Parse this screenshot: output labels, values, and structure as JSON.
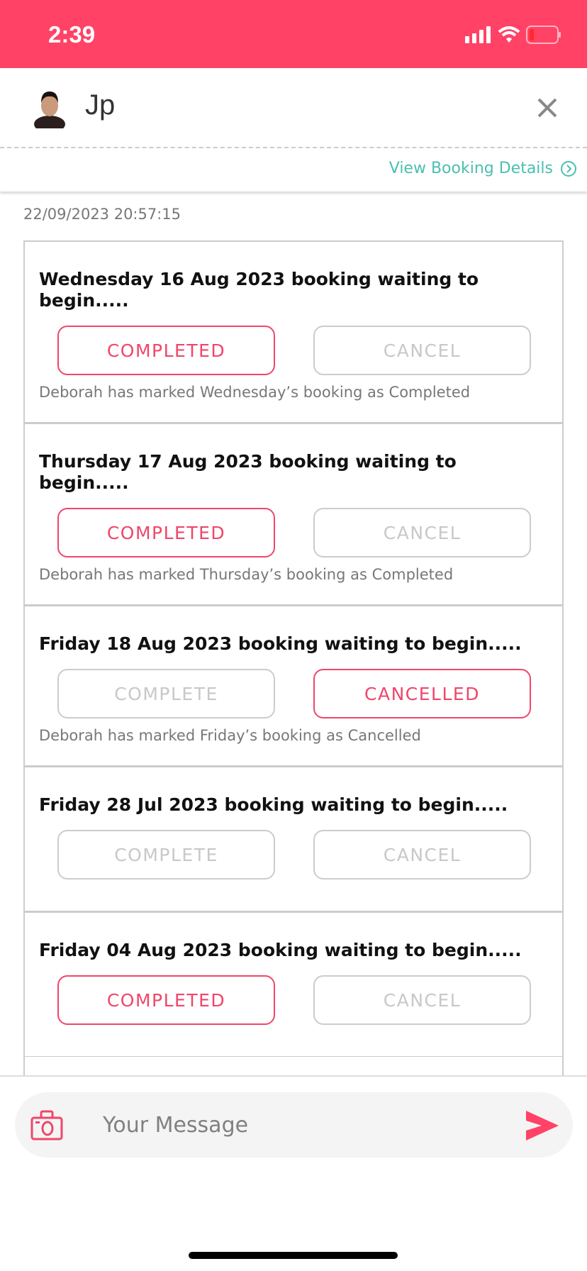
{
  "status_bar": {
    "time": "2:39",
    "icons": [
      "signal-icon",
      "wifi-icon",
      "battery-low-icon"
    ]
  },
  "header": {
    "name": "Jp",
    "close_icon": "close-icon"
  },
  "view_booking_details": "View Booking Details",
  "timestamp": "22/09/2023 20:57:15",
  "colors": {
    "brand": "#FF4266",
    "button_active": "#F0466A",
    "link": "#4BBFB0"
  },
  "bookings": [
    {
      "title": "Wednesday 16 Aug 2023 booking waiting to begin.....",
      "left": "COMPLETED",
      "right": "CANCEL",
      "active": "left",
      "note": "Deborah has marked Wednesday’s booking as Completed"
    },
    {
      "title": "Thursday 17 Aug 2023 booking waiting to begin.....",
      "left": "COMPLETED",
      "right": "CANCEL",
      "active": "left",
      "note": "Deborah has marked Thursday’s booking as Completed"
    },
    {
      "title": "Friday 18 Aug 2023 booking waiting to begin.....",
      "left": "COMPLETE",
      "right": "CANCELLED",
      "active": "right",
      "note": "Deborah has marked Friday’s booking as Cancelled"
    },
    {
      "title": "Friday 28 Jul 2023 booking waiting to begin.....",
      "left": "COMPLETE",
      "right": "CANCEL",
      "active": "none",
      "note": ""
    },
    {
      "title": "Friday 04 Aug 2023 booking waiting to begin.....",
      "left": "COMPLETED",
      "right": "CANCEL",
      "active": "left",
      "note": ""
    }
  ],
  "composer": {
    "placeholder": "Your Message",
    "camera_icon": "camera-icon",
    "send_icon": "send-icon"
  }
}
